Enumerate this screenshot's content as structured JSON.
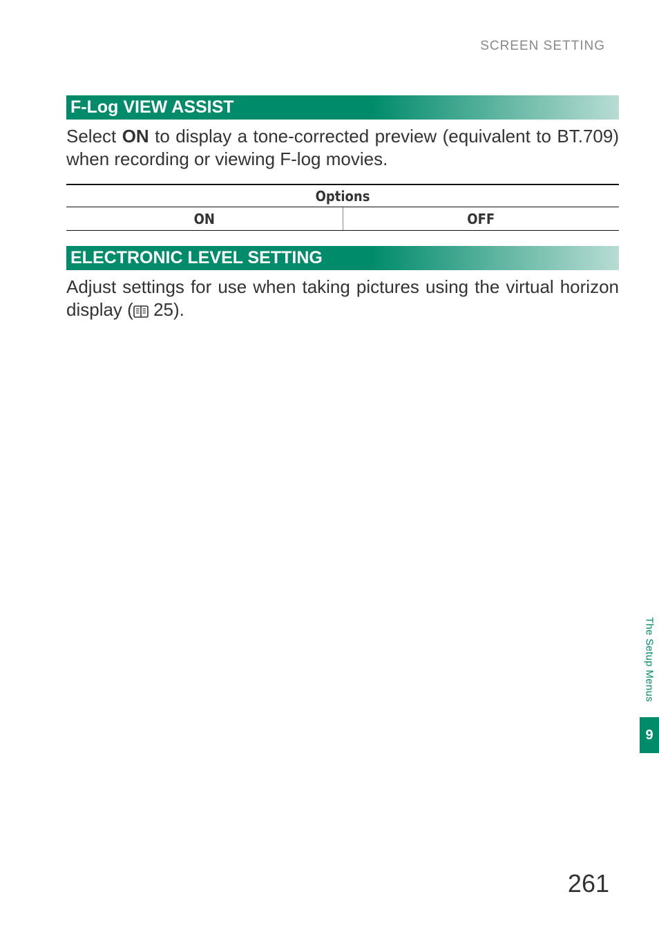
{
  "header": {
    "running_head": "SCREEN SETTING"
  },
  "section1": {
    "title": "F-Log VIEW ASSIST",
    "body_pre": "Select ",
    "body_bold": "ON",
    "body_post": " to display a tone-corrected preview (equivalent to BT.709) when recording or viewing F-log movies.",
    "options_label": "Options",
    "options": {
      "on": "ON",
      "off": "OFF"
    }
  },
  "section2": {
    "title": "ELECTRONIC LEVEL SETTING",
    "body_pre": "Adjust settings for use when taking pictures using the virtual horizon display (",
    "ref_page": "25",
    "body_post": ")."
  },
  "side_tab": {
    "label": "The Setup Menus",
    "chapter": "9"
  },
  "page_number": "261"
}
